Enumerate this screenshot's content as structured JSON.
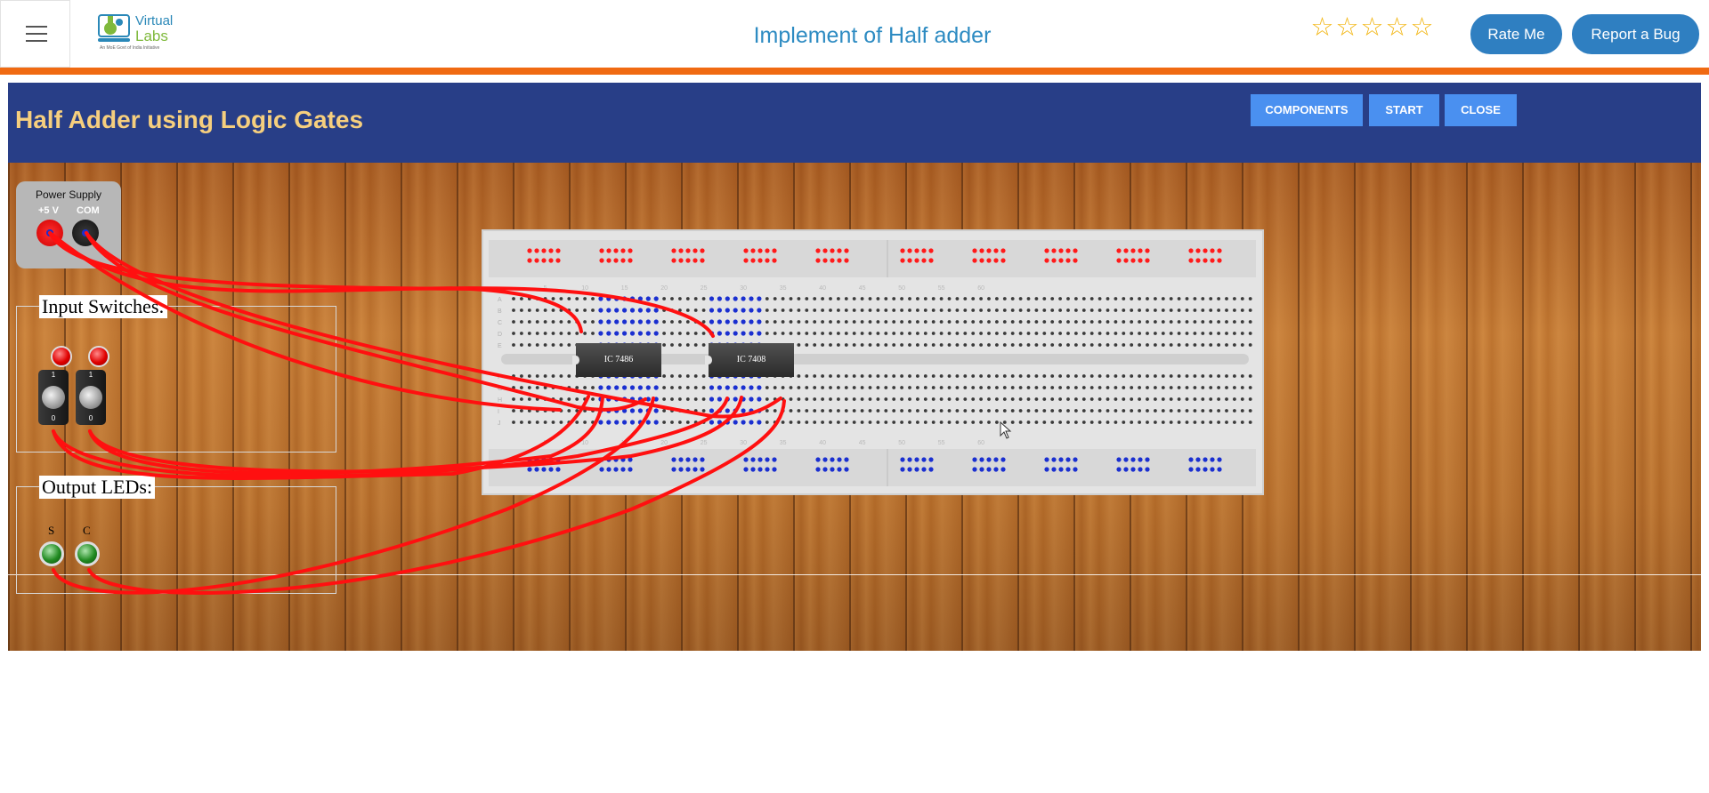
{
  "header": {
    "title": "Implement of Half adder",
    "logo": {
      "word1": "Virtual",
      "word2": "Labs",
      "tagline": "An MoE Govt of India Initiative"
    },
    "rating": {
      "stars_total": 5,
      "stars_filled": 0
    },
    "rate_label": "Rate Me",
    "bug_label": "Report a Bug"
  },
  "simulator": {
    "title": "Half Adder using Logic Gates",
    "buttons": {
      "components": "COMPONENTS",
      "start": "START",
      "close": "CLOSE"
    },
    "power_supply": {
      "label": "Power Supply",
      "plus": "+5 V",
      "com": "COM"
    },
    "input_panel": {
      "title": "Input Switches:",
      "switch_on_label": "1",
      "switch_off_label": "0"
    },
    "output_panel": {
      "title": "Output LEDs:",
      "led_labels": [
        "S",
        "C"
      ]
    },
    "ics": [
      {
        "label": "IC 7486"
      },
      {
        "label": "IC 7408"
      }
    ],
    "breadboard": {
      "row_letters_top": [
        "A",
        "B",
        "C",
        "D",
        "E"
      ],
      "row_letters_bottom": [
        "F",
        "G",
        "H",
        "I",
        "J"
      ],
      "column_numbers": [
        "5",
        "10",
        "15",
        "20",
        "25",
        "30",
        "35",
        "40",
        "45",
        "50",
        "55",
        "60"
      ]
    },
    "colors": {
      "header_bg": "#283e87",
      "title_color": "#f6cf7e",
      "button_bg": "#4a90f0",
      "wire": "#ff0000",
      "rail_top_holes": "#ff1a1a",
      "rail_bottom_holes": "#1a2fd0",
      "connected_holes": "#1a2fd0"
    }
  }
}
